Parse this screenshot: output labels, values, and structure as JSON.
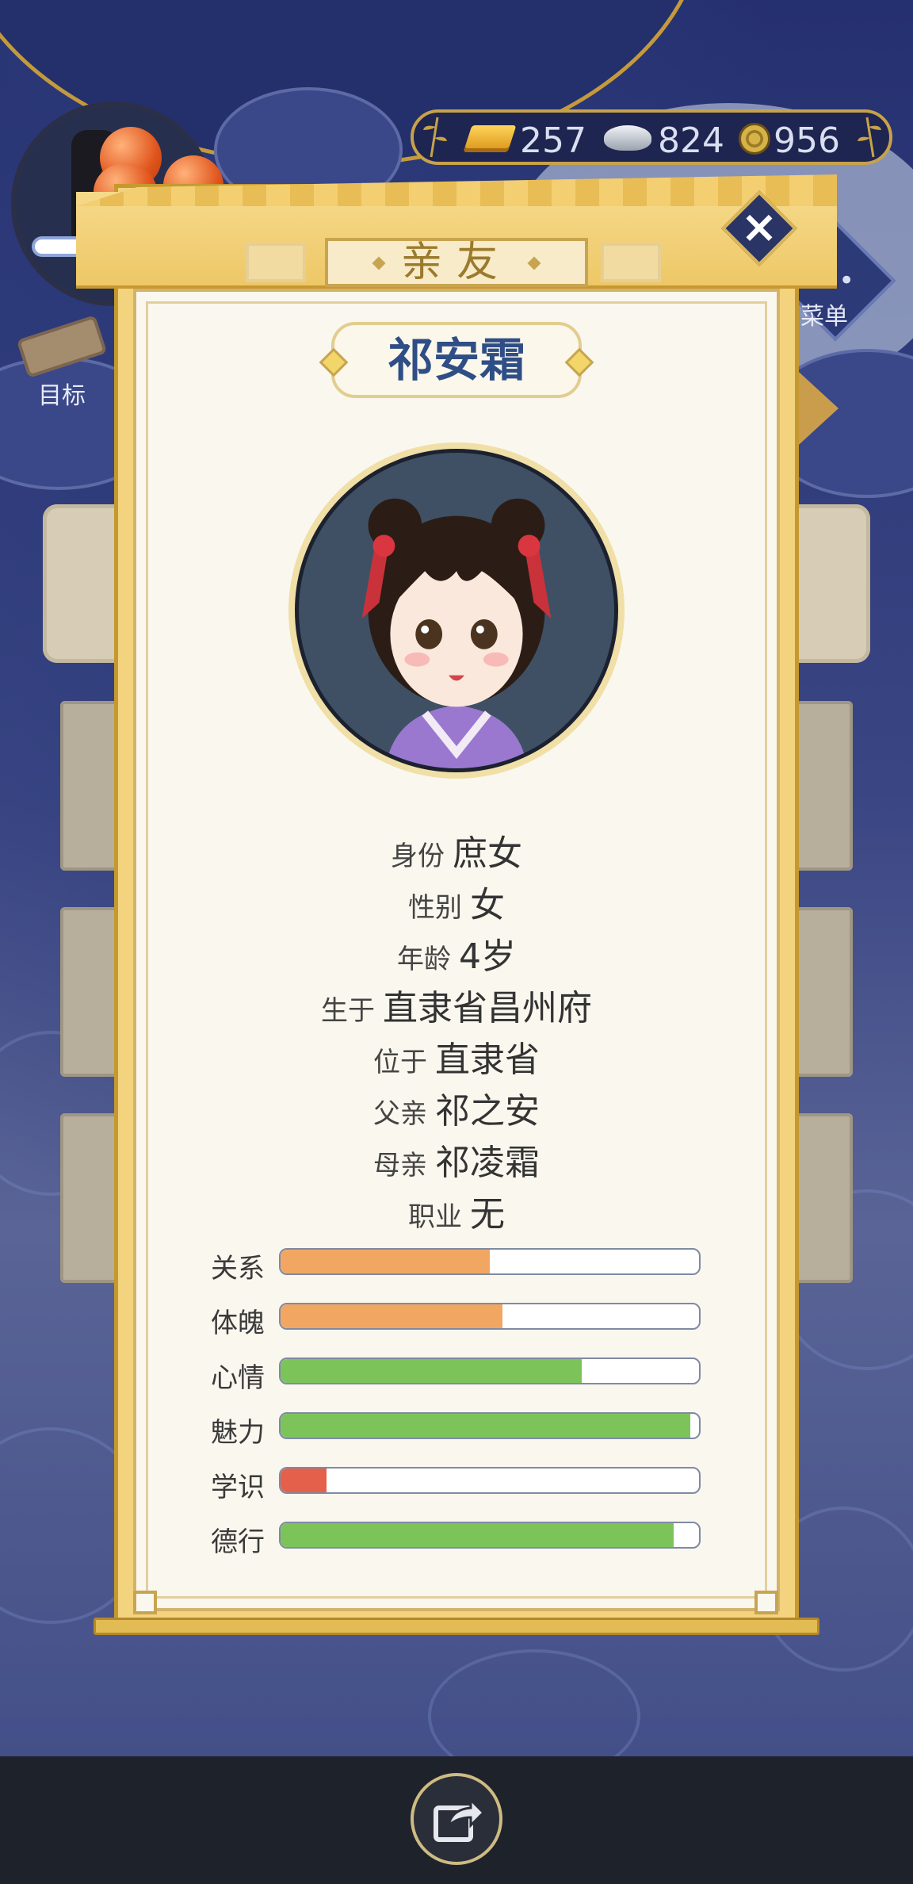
{
  "hud": {
    "goal_label": "目标",
    "menu_label": "菜单",
    "currency": {
      "gold": "257",
      "silver": "824",
      "coins": "956"
    }
  },
  "dialog": {
    "title": "亲友",
    "name": "祁安霜",
    "info": [
      {
        "key": "身份",
        "value": "庶女"
      },
      {
        "key": "性别",
        "value": "女"
      },
      {
        "key": "年龄",
        "value": "4岁"
      },
      {
        "key": "生于",
        "value": "直隶省昌州府"
      },
      {
        "key": "位于",
        "value": "直隶省"
      },
      {
        "key": "父亲",
        "value": "祁之安"
      },
      {
        "key": "母亲",
        "value": "祁凌霜"
      },
      {
        "key": "职业",
        "value": "无"
      }
    ],
    "stats": [
      {
        "label": "关系",
        "percent": 50,
        "color": "#f1a762"
      },
      {
        "label": "体魄",
        "percent": 53,
        "color": "#f1a762"
      },
      {
        "label": "心情",
        "percent": 72,
        "color": "#7cc45a"
      },
      {
        "label": "魅力",
        "percent": 98,
        "color": "#7cc45a"
      },
      {
        "label": "学识",
        "percent": 11,
        "color": "#e5604a"
      },
      {
        "label": "德行",
        "percent": 94,
        "color": "#7cc45a"
      }
    ]
  }
}
